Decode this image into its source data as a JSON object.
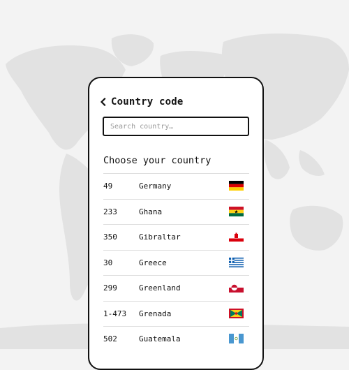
{
  "header": {
    "back_icon": "chevron-left-icon",
    "title": "Country code"
  },
  "search": {
    "placeholder": "Search country…",
    "value": ""
  },
  "list": {
    "heading": "Choose your country",
    "countries": [
      {
        "code": "49",
        "name": "Germany",
        "flag_icon": "germany-flag-icon"
      },
      {
        "code": "233",
        "name": "Ghana",
        "flag_icon": "ghana-flag-icon"
      },
      {
        "code": "350",
        "name": "Gibraltar",
        "flag_icon": "gibraltar-flag-icon"
      },
      {
        "code": "30",
        "name": "Greece",
        "flag_icon": "greece-flag-icon"
      },
      {
        "code": "299",
        "name": "Greenland",
        "flag_icon": "greenland-flag-icon"
      },
      {
        "code": "1-473",
        "name": "Grenada",
        "flag_icon": "grenada-flag-icon"
      },
      {
        "code": "502",
        "name": "Guatemala",
        "flag_icon": "guatemala-flag-icon"
      }
    ]
  },
  "colors": {
    "background": "#f3f3f3",
    "map": "#e3e3e3",
    "border": "#111111",
    "divider": "#dedede"
  }
}
